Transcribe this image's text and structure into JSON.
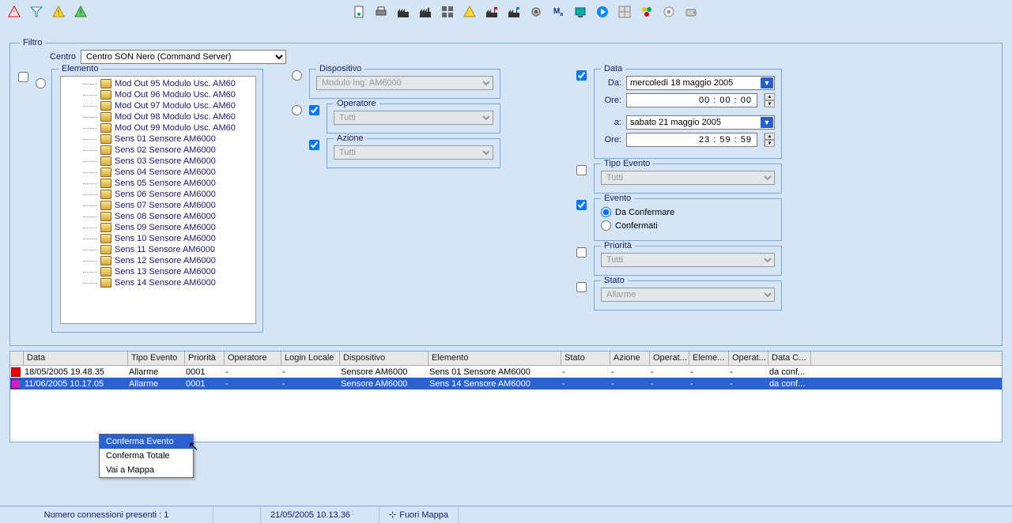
{
  "toolbar_icons": [
    "alert-triangle",
    "filter",
    "alert-a",
    "alert-b"
  ],
  "toolbar_right_icons": [
    "cfg",
    "print",
    "factory",
    "factory2",
    "grid4",
    "alert",
    "factory-flag",
    "factory-flag2",
    "cog",
    "ma",
    "monitor",
    "play",
    "grid16",
    "circles",
    "disc",
    "disk"
  ],
  "filter": {
    "title": "Filtro",
    "centro_label": "Centro",
    "centro_value": "Centro SON Nero (Command Server)",
    "elemento": {
      "title": "Elemento",
      "items": [
        "Mod Out 95 Modulo Usc. AM60",
        "Mod Out 96 Modulo Usc. AM60",
        "Mod Out 97 Modulo Usc. AM60",
        "Mod Out 98 Modulo Usc. AM60",
        "Mod Out 99 Modulo Usc. AM60",
        "Sens 01 Sensore AM6000",
        "Sens 02 Sensore AM6000",
        "Sens 03 Sensore AM6000",
        "Sens 04 Sensore AM6000",
        "Sens 05 Sensore AM6000",
        "Sens 06 Sensore AM6000",
        "Sens 07 Sensore AM6000",
        "Sens 08 Sensore AM6000",
        "Sens 09 Sensore AM6000",
        "Sens 10 Sensore AM6000",
        "Sens 11 Sensore AM6000",
        "Sens 12 Sensore AM6000",
        "Sens 13 Sensore AM6000",
        "Sens 14 Sensore AM6000"
      ]
    },
    "dispositivo": {
      "title": "Dispositivo",
      "value": "Modulo Ing. AM6000"
    },
    "operatore": {
      "title": "Operatore",
      "value": "Tutti"
    },
    "azione": {
      "title": "Azione",
      "value": "Tutti"
    },
    "data": {
      "title": "Data",
      "da_label": "Da:",
      "da_value": "mercoledì 18  maggio  2005",
      "ore_label": "Ore:",
      "da_ore": "00 : 00 : 00",
      "a_label": "a:",
      "a_value": "sabato  21  maggio  2005",
      "a_ore": "23 : 59 : 59"
    },
    "tipo_evento": {
      "title": "Tipo Evento",
      "value": "Tutti"
    },
    "evento": {
      "title": "Evento",
      "da_confermare": "Da Confermare",
      "confermati": "Confermati"
    },
    "priorita": {
      "title": "Priorità",
      "value": "Tutti"
    },
    "stato": {
      "title": "Stato",
      "value": "Allarme"
    }
  },
  "table": {
    "columns": [
      "Data",
      "Tipo Evento",
      "Priorità",
      "Operatore",
      "Login Locale",
      "Dispositivo",
      "Elemento",
      "Stato",
      "Azione",
      "Operat...",
      "Eleme...",
      "Operat...",
      "Data C..."
    ],
    "rows": [
      {
        "color": "red",
        "cells": [
          "18/05/2005 19.48.35",
          "Allarme",
          "0001",
          "-",
          "-",
          "Sensore AM6000",
          "Sens 01 Sensore AM6000",
          "-",
          "-",
          "-",
          "-",
          "-",
          "da conf..."
        ]
      },
      {
        "color": "mag",
        "sel": true,
        "cells": [
          "11/06/2005 10.17.05",
          "Allarme",
          "0001",
          "-",
          "-",
          "Sensore AM6000",
          "Sens 14 Sensore AM6000",
          "-",
          "-",
          "-",
          "-",
          "-",
          "da conf..."
        ]
      }
    ]
  },
  "context_menu": [
    "Conferma Evento",
    "Conferma Totale",
    "Vai a Mappa"
  ],
  "status": {
    "conn": "Numero connessioni presenti : 1",
    "ts": "21/05/2005 10.13.36",
    "map": "Fuori Mappa"
  }
}
